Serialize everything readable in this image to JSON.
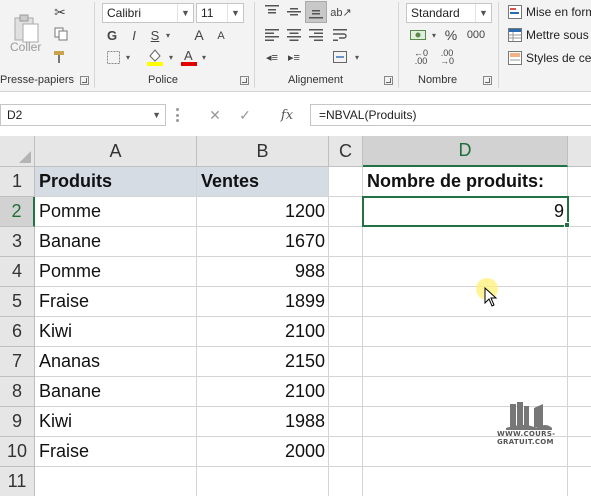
{
  "ribbon": {
    "clipboard": {
      "label": "Presse-papiers",
      "paste_label": "Coller"
    },
    "font": {
      "label": "Police",
      "font_name": "Calibri",
      "font_size": "11",
      "bold": "G",
      "italic": "I",
      "underline": "S",
      "increase": "A",
      "decrease": "A"
    },
    "alignment": {
      "label": "Alignement"
    },
    "number": {
      "label": "Nombre",
      "format": "Standard",
      "percent": "%",
      "thousands": "000"
    },
    "styles": {
      "conditional": "Mise en form",
      "table": "Mettre sous",
      "cell_styles": "Styles de cel"
    }
  },
  "formula_bar": {
    "name_box": "D2",
    "fx": "fx",
    "formula": "=NBVAL(Produits)"
  },
  "columns": [
    "A",
    "B",
    "C",
    "D"
  ],
  "rows": [
    "1",
    "2",
    "3",
    "4",
    "5",
    "6",
    "7",
    "8",
    "9",
    "10",
    "11"
  ],
  "table": {
    "headers": {
      "produit": "Produits",
      "ventes": "Ventes"
    },
    "data": [
      {
        "produit": "Pomme",
        "ventes": "1200"
      },
      {
        "produit": "Banane",
        "ventes": "1670"
      },
      {
        "produit": "Pomme",
        "ventes": "988"
      },
      {
        "produit": "Fraise",
        "ventes": "1899"
      },
      {
        "produit": "Kiwi",
        "ventes": "2100"
      },
      {
        "produit": "Ananas",
        "ventes": "2150"
      },
      {
        "produit": "Banane",
        "ventes": "2100"
      },
      {
        "produit": "Kiwi",
        "ventes": "1988"
      },
      {
        "produit": "Fraise",
        "ventes": "2000"
      }
    ]
  },
  "result": {
    "label": "Nombre de produits:",
    "value": "9"
  },
  "watermark": {
    "text": "WWW.COURS-GRATUIT.COM"
  },
  "colors": {
    "accent": "#217346",
    "table_header_fill": "#d6dce4"
  }
}
